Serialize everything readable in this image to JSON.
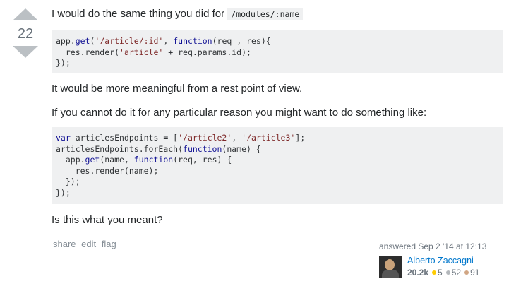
{
  "vote": {
    "count": "22"
  },
  "post": {
    "intro_text": "I would do the same thing you did for",
    "intro_code": "/modules/:name",
    "code1": [
      [
        {
          "t": "app.",
          "c": ""
        },
        {
          "t": "get",
          "c": "kw"
        },
        {
          "t": "(",
          "c": ""
        },
        {
          "t": "'/article/:id'",
          "c": "str"
        },
        {
          "t": ", ",
          "c": ""
        },
        {
          "t": "function",
          "c": "kw"
        },
        {
          "t": "(req , res){",
          "c": ""
        }
      ],
      [
        {
          "t": "  res.render(",
          "c": ""
        },
        {
          "t": "'article'",
          "c": "str"
        },
        {
          "t": " + req.params.id);",
          "c": ""
        }
      ],
      [
        {
          "t": "});",
          "c": ""
        }
      ]
    ],
    "para2": "It would be more meaningful from a rest point of view.",
    "para3": "If you cannot do it for any particular reason you might want to do something like:",
    "code2": [
      [
        {
          "t": "var",
          "c": "kw"
        },
        {
          "t": " articlesEndpoints = [",
          "c": ""
        },
        {
          "t": "'/article2'",
          "c": "str"
        },
        {
          "t": ", ",
          "c": ""
        },
        {
          "t": "'/article3'",
          "c": "str"
        },
        {
          "t": "];",
          "c": ""
        }
      ],
      [
        {
          "t": "articlesEndpoints.forEach(",
          "c": ""
        },
        {
          "t": "function",
          "c": "kw"
        },
        {
          "t": "(name) {",
          "c": ""
        }
      ],
      [
        {
          "t": "  app.",
          "c": ""
        },
        {
          "t": "get",
          "c": "kw"
        },
        {
          "t": "(name, ",
          "c": ""
        },
        {
          "t": "function",
          "c": "kw"
        },
        {
          "t": "(req, res) {",
          "c": ""
        }
      ],
      [
        {
          "t": "    res.render(name);",
          "c": ""
        }
      ],
      [
        {
          "t": "  });",
          "c": ""
        }
      ],
      [
        {
          "t": "});",
          "c": ""
        }
      ]
    ],
    "para4": "Is this what you meant?"
  },
  "menu": {
    "share": "share",
    "edit": "edit",
    "flag": "flag"
  },
  "signature": {
    "action_time": "answered Sep 2 '14 at 12:13",
    "user_name": "Alberto Zaccagni",
    "reputation": "20.2k",
    "gold": "5",
    "silver": "52",
    "bronze": "91",
    "colors": {
      "gold": "#ffcc01",
      "silver": "#b4b8bc",
      "bronze": "#d1a684"
    }
  }
}
